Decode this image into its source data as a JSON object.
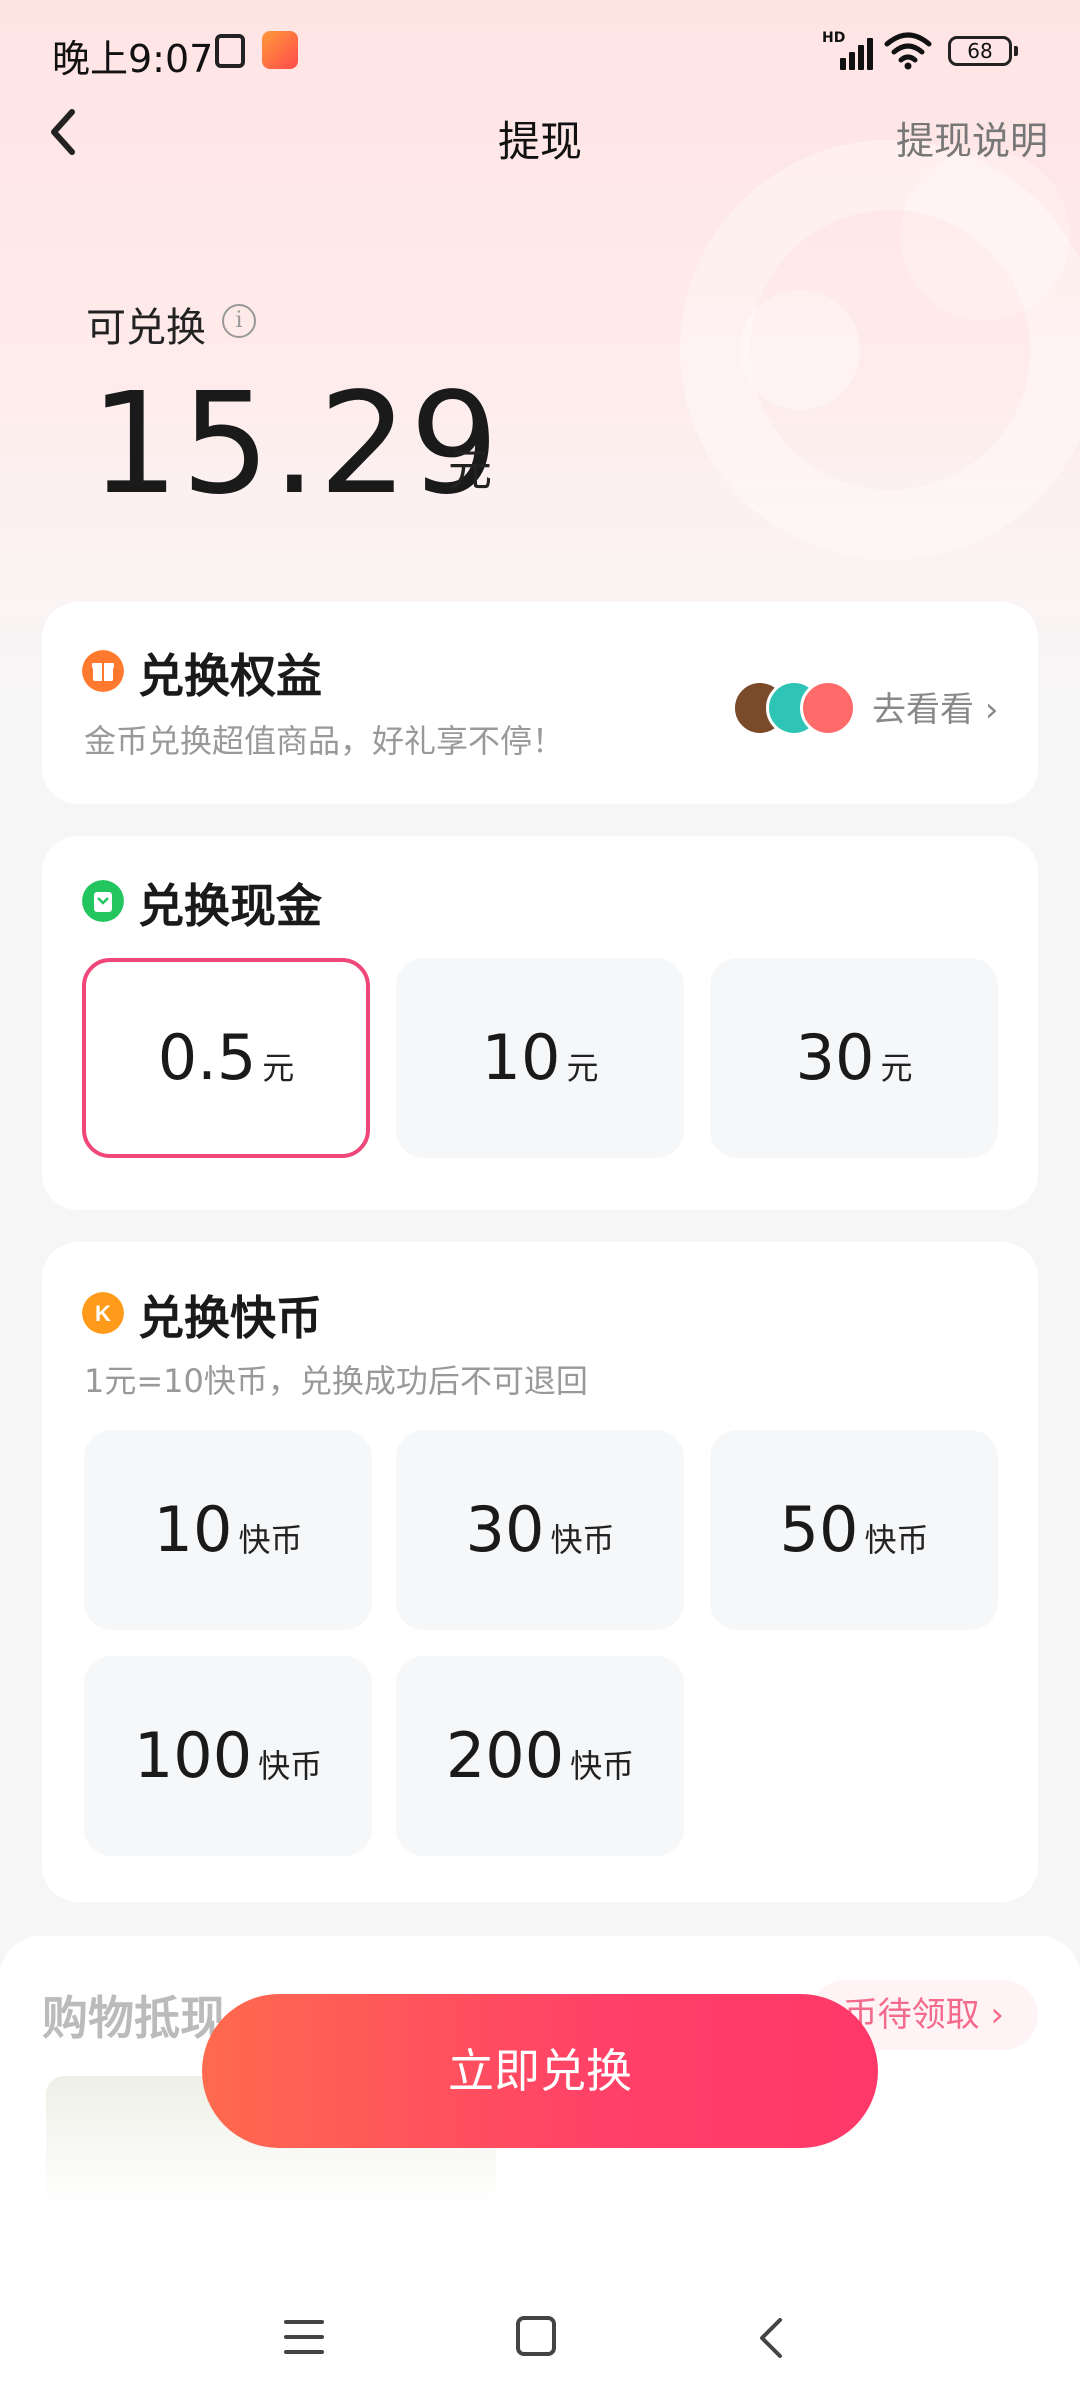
{
  "status_bar": {
    "time": "晚上9:07",
    "network": "HD",
    "battery": "68"
  },
  "nav": {
    "title": "提现",
    "right_link": "提现说明"
  },
  "balance": {
    "label": "可兑换",
    "amount": "15.29",
    "unit": "元"
  },
  "rights_card": {
    "title": "兑换权益",
    "subtitle": "金币兑换超值商品，好礼享不停！",
    "link": "去看看",
    "avatars": [
      {
        "name": "game-avatar-icon",
        "color": "#7a4a2a"
      },
      {
        "name": "video-play-icon",
        "color": "#2ec4b6"
      },
      {
        "name": "coupon-icon",
        "color": "#ff6b6b"
      }
    ]
  },
  "cash_card": {
    "title": "兑换现金",
    "options": [
      {
        "value": "0.5",
        "unit": "元",
        "selected": true
      },
      {
        "value": "10",
        "unit": "元",
        "selected": false
      },
      {
        "value": "30",
        "unit": "元",
        "selected": false
      }
    ]
  },
  "coin_card": {
    "title": "兑换快币",
    "subtitle": "1元=10快币，兑换成功后不可退回",
    "icon_letter": "K",
    "options": [
      {
        "value": "10",
        "unit": "快币"
      },
      {
        "value": "30",
        "unit": "快币"
      },
      {
        "value": "50",
        "unit": "快币"
      },
      {
        "value": "100",
        "unit": "快币"
      },
      {
        "value": "200",
        "unit": "快币"
      }
    ]
  },
  "shopping": {
    "title": "购物抵现",
    "pill": "币待领取 ›"
  },
  "cta": {
    "label": "立即兑换"
  },
  "colors": {
    "accent": "#ff3869",
    "selected_border": "#f0477a",
    "rights_icon": "#ff7a2f",
    "cash_icon": "#22c55e",
    "coin_icon": "#ff9a1a"
  }
}
